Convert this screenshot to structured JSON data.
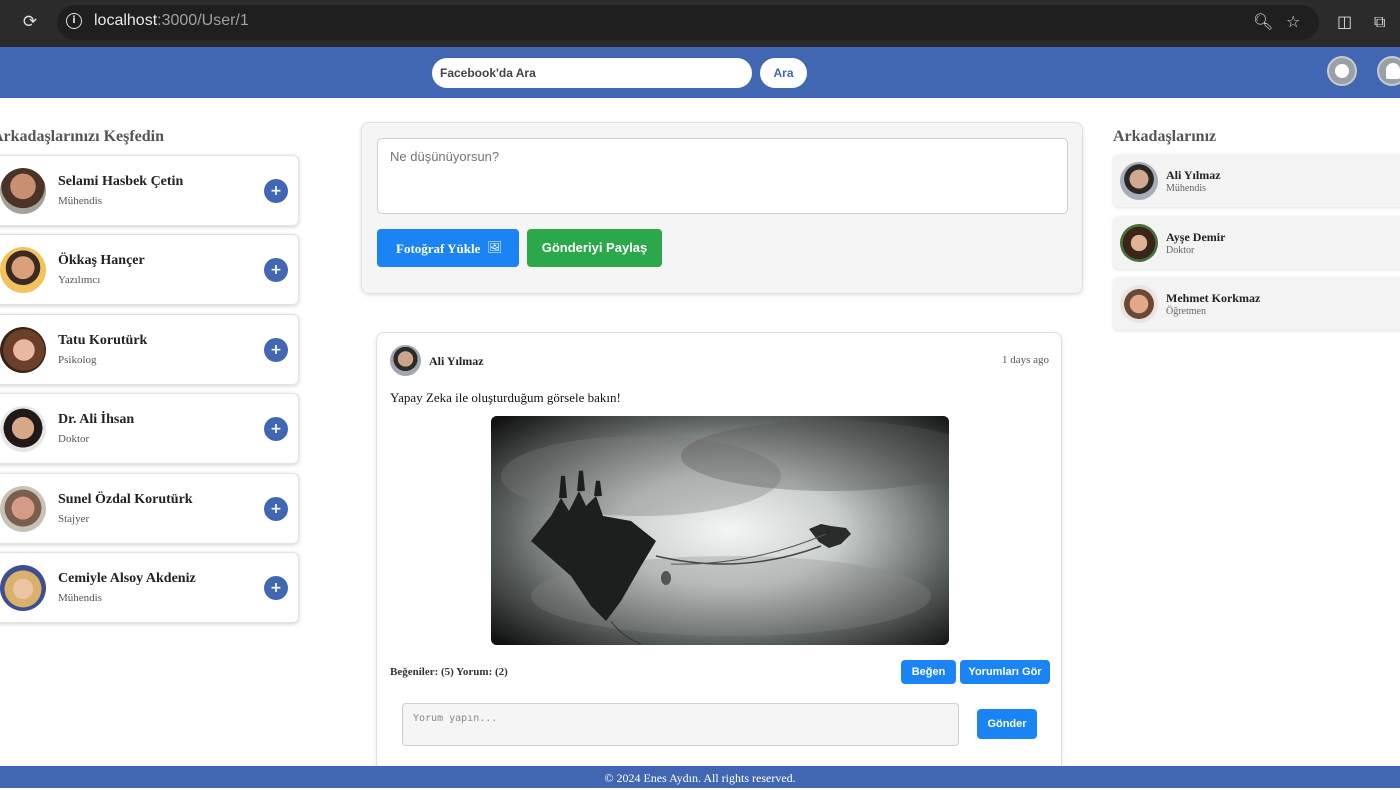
{
  "browser": {
    "url_host": "localhost",
    "url_path": ":3000/User/1"
  },
  "header": {
    "search_placeholder": "Facebook'da Ara",
    "search_button": "Ara"
  },
  "discover": {
    "title": "Arkadaşlarınızı Keşfedin",
    "people": [
      {
        "name": "Selami Hasbek Çetin",
        "job": "Mühendis",
        "add": "+"
      },
      {
        "name": "Ökkaş Hançer",
        "job": "Yazılımcı",
        "add": "+"
      },
      {
        "name": "Tatu Korutürk",
        "job": "Psikolog",
        "add": "+"
      },
      {
        "name": "Dr. Ali İhsan",
        "job": "Doktor",
        "add": "+"
      },
      {
        "name": "Sunel Özdal Korutürk",
        "job": "Stajyer",
        "add": "+"
      },
      {
        "name": "Cemiyle Alsoy Akdeniz",
        "job": "Mühendis",
        "add": "+"
      }
    ]
  },
  "composer": {
    "placeholder": "Ne düşünüyorsun?",
    "upload_label": "Fotoğraf Yükle",
    "share_label": "Gönderiyi Paylaş"
  },
  "post": {
    "author": "Ali Yılmaz",
    "time": "1 days ago",
    "text": "Yapay Zeka ile oluşturduğum görsele bakın!",
    "stats": "Beğeniler: (5) Yorum: (2)",
    "like_label": "Beğen",
    "comments_label": "Yorumları Gör",
    "comment_placeholder": "Yorum yapın...",
    "send_label": "Gönder"
  },
  "friends": {
    "title": "Arkadaşlarınız",
    "list": [
      {
        "name": "Ali Yılmaz",
        "job": "Mühendis"
      },
      {
        "name": "Ayşe Demir",
        "job": "Doktor"
      },
      {
        "name": "Mehmet Korkmaz",
        "job": "Öğretmen"
      }
    ]
  },
  "footer": {
    "text": "© 2024 Enes Aydın. All rights reserved."
  }
}
